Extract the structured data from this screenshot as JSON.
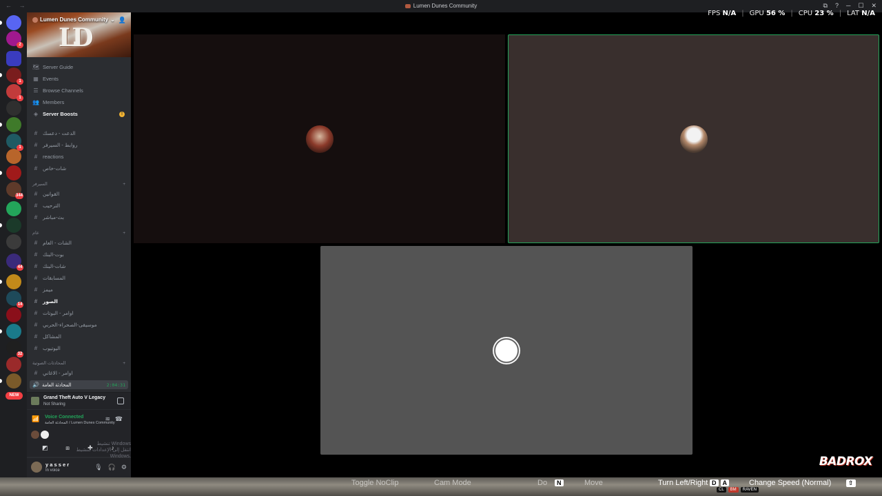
{
  "window": {
    "title": "Lumen Dunes Community",
    "nav": "← →",
    "controls": [
      "⧉",
      "?",
      "─",
      "☐",
      "✕"
    ]
  },
  "perf": {
    "fps_label": "FPS",
    "fps_value": "N/A",
    "gpu_label": "GPU",
    "gpu_value": "56 %",
    "cpu_label": "CPU",
    "cpu_value": "23 %",
    "lat_label": "LAT",
    "lat_value": "N/A",
    "separator": "|"
  },
  "rail": {
    "new_badge": "NEW",
    "servers": [
      {
        "color": "#5865f2",
        "badge": ""
      },
      {
        "color": "#a0198e",
        "badge": "2"
      },
      {
        "color": "#3a3cbf",
        "badge": ""
      },
      {
        "color": "#7a1d1d",
        "badge": "1"
      },
      {
        "color": "#c23b3b",
        "badge": "1"
      },
      {
        "color": "#2f2f2f",
        "badge": ""
      },
      {
        "color": "#3f7a2a",
        "badge": ""
      },
      {
        "color": "#1f5a63",
        "badge": "1"
      },
      {
        "color": "#b8652b",
        "badge": ""
      },
      {
        "color": "#a01a1a",
        "badge": ""
      },
      {
        "color": "#5e3a2a",
        "badge": "344"
      },
      {
        "color": "#23a55a",
        "badge": ""
      },
      {
        "color": "#1b3a2a",
        "badge": ""
      },
      {
        "color": "#3b3b3b",
        "badge": ""
      },
      {
        "color": "#3a2a7a",
        "badge": "44"
      },
      {
        "color": "#c28a1a",
        "badge": ""
      },
      {
        "color": "#1e4a5a",
        "badge": "14"
      },
      {
        "color": "#8a0f1a",
        "badge": ""
      },
      {
        "color": "#1a7a8a",
        "badge": ""
      },
      {
        "color": "#1f1f1f",
        "badge": "32"
      },
      {
        "color": "#9a2a2a",
        "badge": ""
      },
      {
        "color": "#7a5a2a",
        "badge": ""
      }
    ]
  },
  "sidebar": {
    "server_name": "Lumen Dunes Community",
    "banner_logo": "LD",
    "menu": [
      {
        "icon": "🗺",
        "label": "Server Guide"
      },
      {
        "icon": "▦",
        "label": "Events"
      },
      {
        "icon": "☰",
        "label": "Browse Channels"
      },
      {
        "icon": "👥",
        "label": "Members"
      },
      {
        "icon": "◈",
        "label": "Server Boosts",
        "badge": "!"
      }
    ],
    "channels_a": [
      "الدعت - دعسك",
      "روابط - السيرفر",
      "reactions",
      "شات-خاص"
    ],
    "category_b": "السيرفر",
    "channels_b": [
      "القوانين",
      "الترحيب",
      "بث-مباشر"
    ],
    "category_c": "عام",
    "channels_c": [
      "الشات - العام",
      "بوت-البنك",
      "شات-البنك",
      "المسابقات",
      "ميمز",
      "الصور",
      "اوامر - البوتات",
      "موسيقى-الصحراء-الحربي",
      "المشاكل",
      "اليوتيوب"
    ],
    "category_d": "المحادثات الصوتية",
    "channels_d": [
      "اوامر - الاغاني"
    ],
    "voice_channel": "المحادثة العامة",
    "voice_timer": "2:04:31"
  },
  "game_panel": {
    "name": "Grand Theft Auto V Legacy",
    "status": "Not Sharing"
  },
  "voice_panel": {
    "title": "Voice Connected",
    "subtitle": "المحادثة العامة / Lumen Dunes Community",
    "watermark_line1": "تنشيط Windows",
    "watermark_line2": "انتقل إلى الإعدادات لتنشيط Windows."
  },
  "user_panel": {
    "name": "y a s s e r",
    "status": "In voice"
  },
  "brand": "BADROX",
  "hud": {
    "items": [
      "Toggle NoClip",
      "Cam Mode",
      "Do",
      "Move",
      "Turn Left/Right",
      "Change Speed (Normal)"
    ],
    "keys": [
      "N",
      "D",
      "A",
      "⇧"
    ],
    "strip": [
      "CL",
      "BM",
      "RAVEN"
    ]
  }
}
